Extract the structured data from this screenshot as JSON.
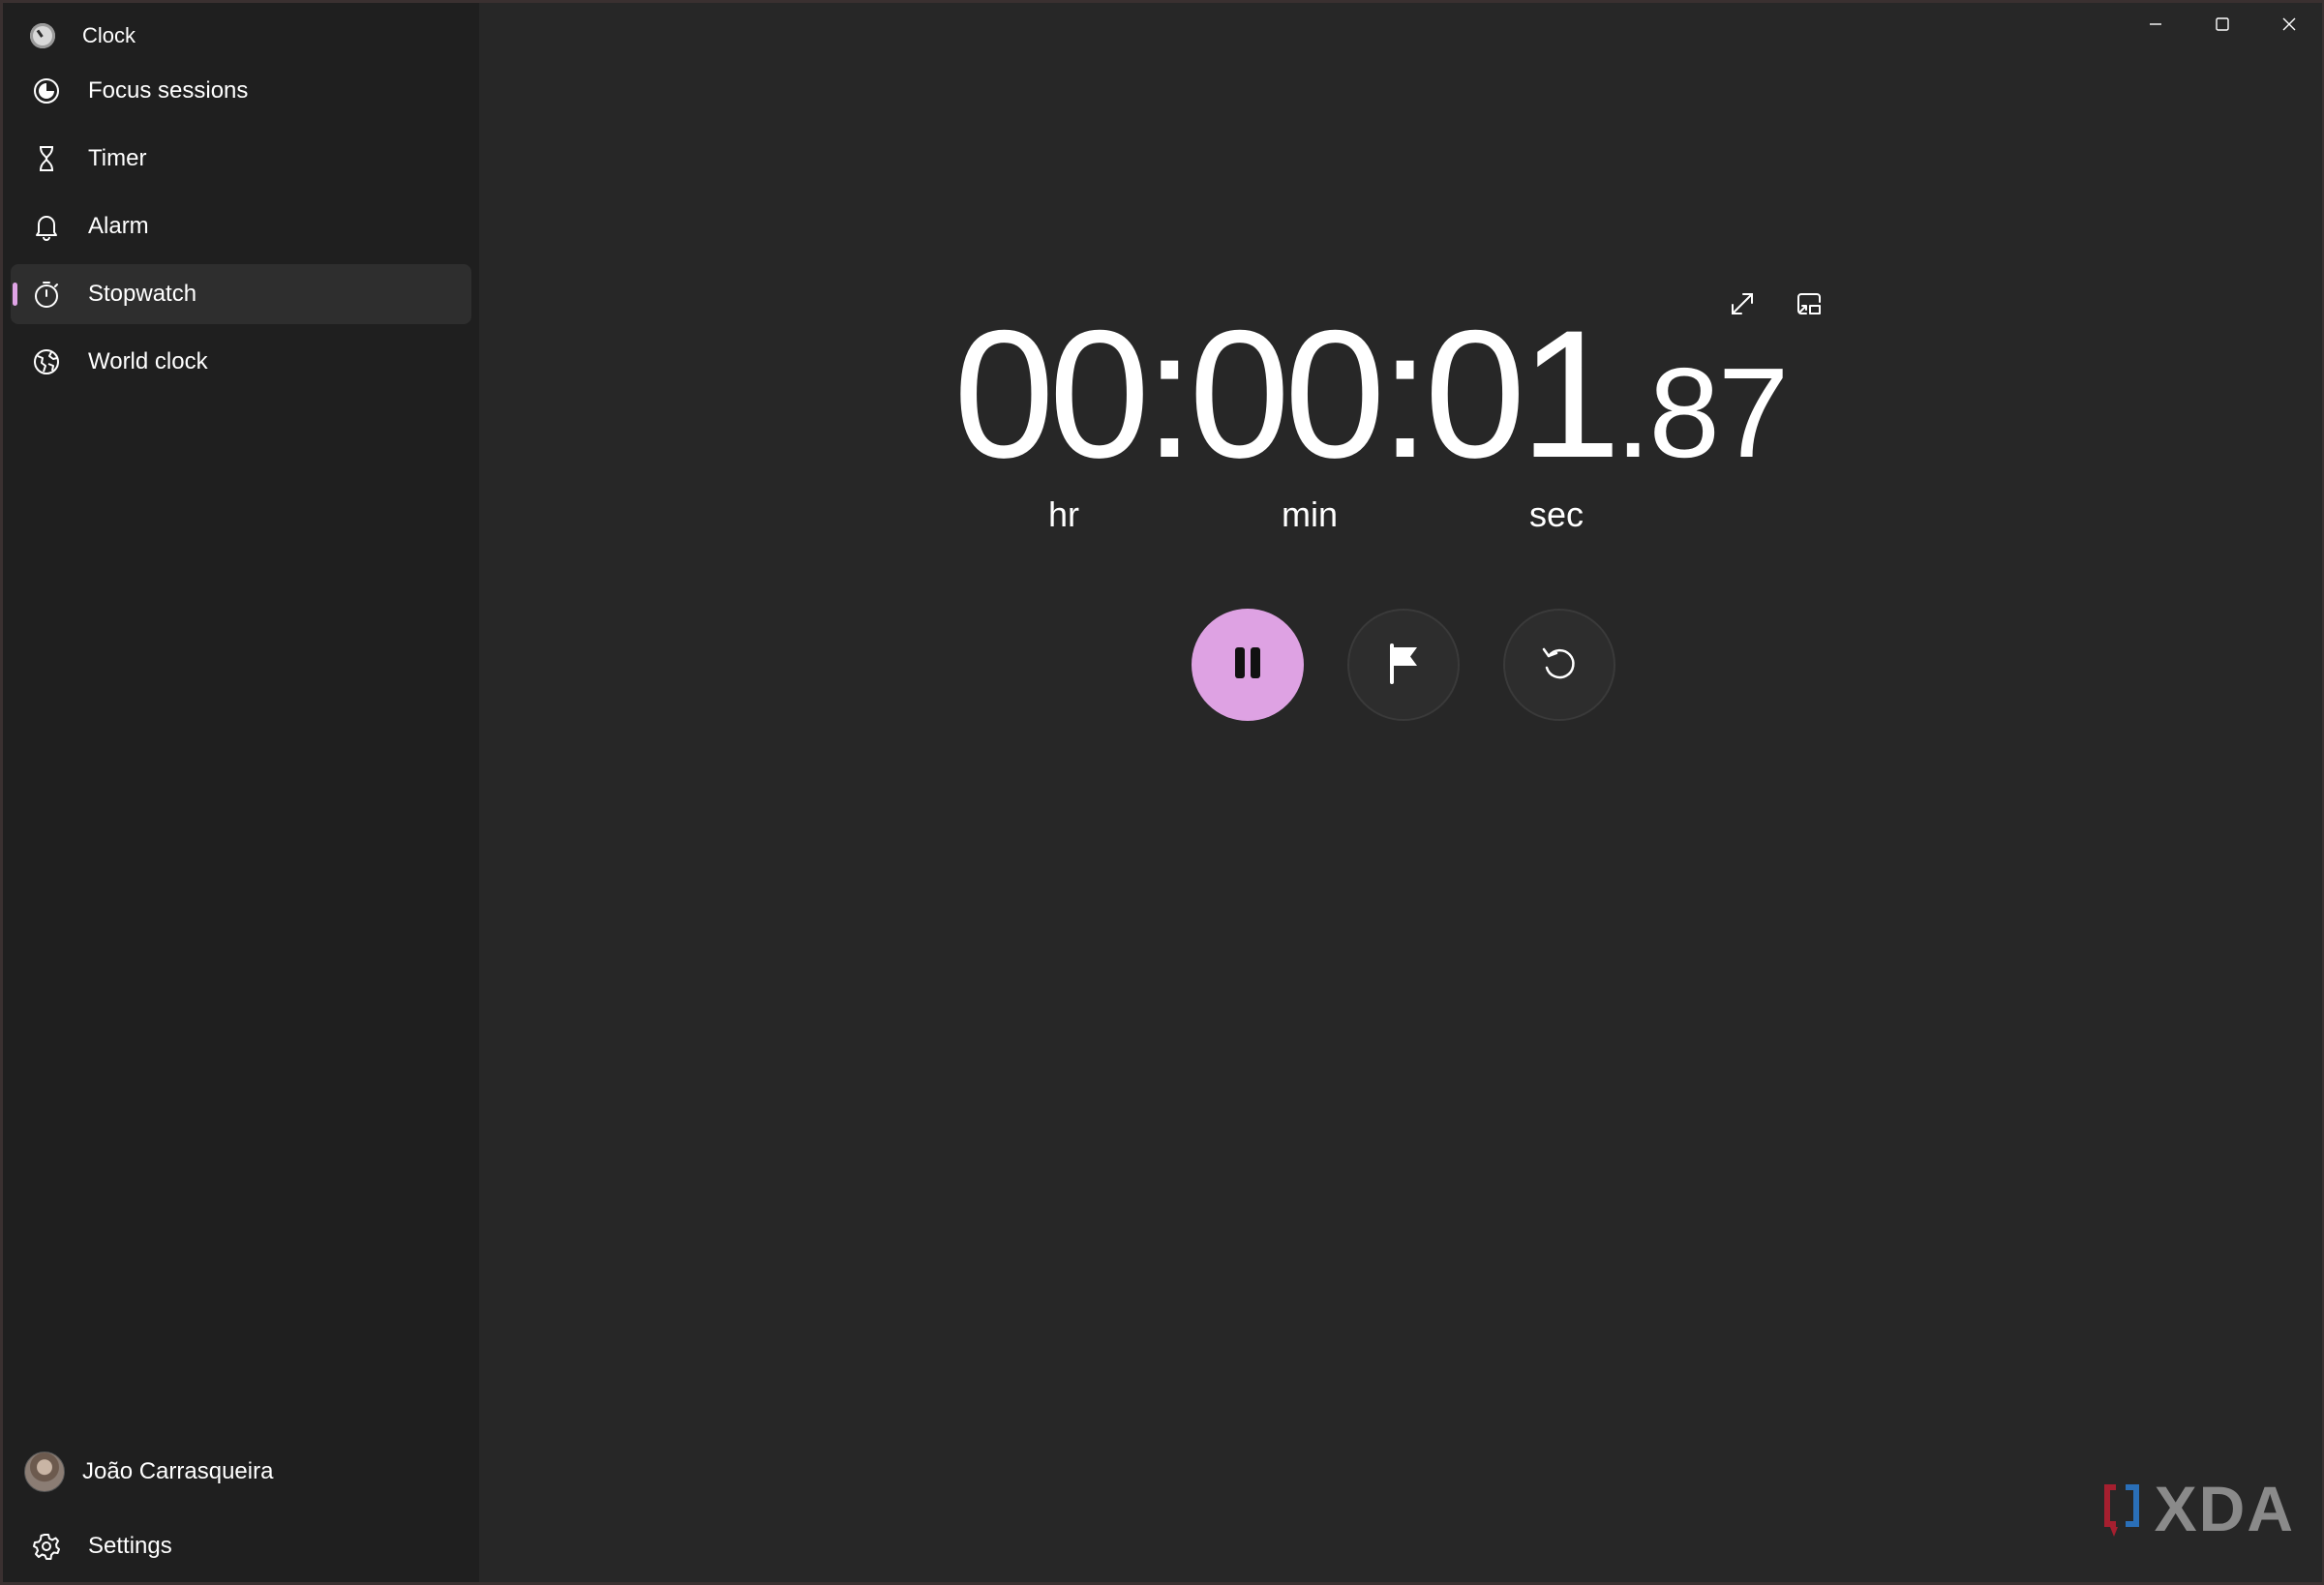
{
  "app": {
    "title": "Clock",
    "accent_color": "#dea2e3"
  },
  "sidebar": {
    "items": [
      {
        "label": "Focus sessions",
        "icon": "focus-icon",
        "active": false
      },
      {
        "label": "Timer",
        "icon": "hourglass-icon",
        "active": false
      },
      {
        "label": "Alarm",
        "icon": "bell-icon",
        "active": false
      },
      {
        "label": "Stopwatch",
        "icon": "stopwatch-icon",
        "active": true
      },
      {
        "label": "World clock",
        "icon": "globe-icon",
        "active": false
      }
    ],
    "profile_name": "João Carrasqueira",
    "settings_label": "Settings"
  },
  "stopwatch": {
    "time_main": "00:00:01",
    "time_fraction": ".87",
    "units": {
      "hr": "hr",
      "min": "min",
      "sec": "sec"
    },
    "state": "running"
  },
  "watermark": {
    "text": "XDA"
  }
}
